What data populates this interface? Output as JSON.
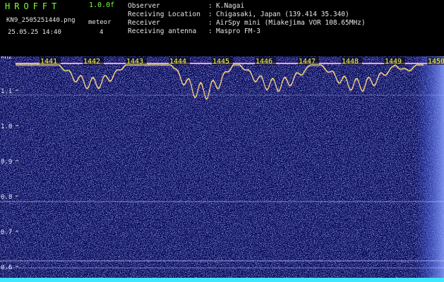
{
  "header": {
    "app_title": "HROFFT",
    "version": "1.0.0f",
    "filename": "KN9_2505251440.png",
    "datetime": "25.05.25 14:40",
    "meteor_label": "meteor",
    "meteor_count": "4"
  },
  "info": [
    {
      "label": "Observer",
      "value": "K.Nagai"
    },
    {
      "label": "Receiving Location",
      "value": "Chigasaki, Japan (139.414 35.340)"
    },
    {
      "label": "Receiver",
      "value": "AirSpy mini (Miakejima VOR 108.65MHz)"
    },
    {
      "label": "Receiving antenna",
      "value": "Maspro FM-3"
    }
  ],
  "spectrogram": {
    "unit": "kHz",
    "y_ticks": [
      "1.1",
      "1.0",
      "0.9",
      "0.8",
      "0.7",
      "0.6"
    ],
    "minute_ticks": [
      "1441",
      "1442",
      "1443",
      "1444",
      "1445",
      "1446",
      "1447",
      "1448",
      "1449",
      "1450"
    ],
    "colors": {
      "background": "#0a0a5a",
      "noise": "#4a6cff",
      "trace": "#e8f070",
      "label": "#ffff40",
      "axis": "#e8e8e8"
    }
  }
}
